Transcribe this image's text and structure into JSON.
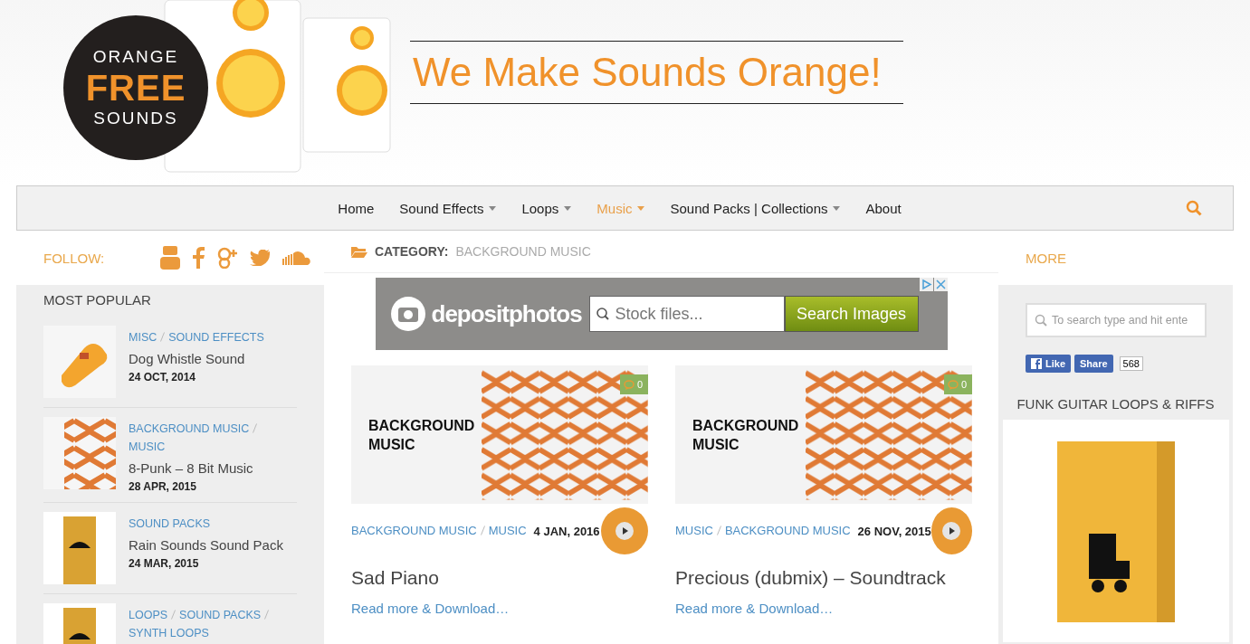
{
  "header": {
    "logo": {
      "lines": [
        "ORANGE",
        "FREE",
        "SOUNDS"
      ]
    },
    "tagline": "We Make Sounds Orange!"
  },
  "nav": {
    "items": [
      {
        "label": "Home",
        "has_menu": false,
        "selected": false
      },
      {
        "label": "Sound Effects",
        "has_menu": true,
        "selected": false
      },
      {
        "label": "Loops",
        "has_menu": true,
        "selected": false
      },
      {
        "label": "Music",
        "has_menu": true,
        "selected": true
      },
      {
        "label": "Sound Packs | Collections",
        "has_menu": true,
        "selected": false
      },
      {
        "label": "About",
        "has_menu": false,
        "selected": false
      }
    ]
  },
  "follow": {
    "label": "FOLLOW:"
  },
  "most_popular": {
    "title": "MOST POPULAR",
    "items": [
      {
        "kind": "whistle",
        "categories": [
          "MISC",
          "SOUND EFFECTS"
        ],
        "title": "Dog Whistle Sound",
        "date": "24 OCT, 2014"
      },
      {
        "kind": "pattern",
        "categories": [
          "BACKGROUND MUSIC",
          "MUSIC"
        ],
        "title": "8-Punk – 8 Bit Music",
        "date": "28 APR, 2015"
      },
      {
        "kind": "box",
        "categories": [
          "SOUND PACKS"
        ],
        "title": "Rain Sounds Sound Pack",
        "date": "24 MAR, 2015"
      },
      {
        "kind": "box",
        "categories": [
          "LOOPS",
          "SOUND PACKS",
          "SYNTH LOOPS"
        ]
      }
    ]
  },
  "category": {
    "label": "CATEGORY:",
    "name": "BACKGROUND MUSIC"
  },
  "ad": {
    "brand": "depositphotos",
    "placeholder": "Stock files...",
    "button": "Search Images"
  },
  "posts": [
    {
      "image_lines": [
        "BACKGROUND",
        "MUSIC"
      ],
      "comments": "0",
      "categories": [
        "BACKGROUND MUSIC",
        "MUSIC"
      ],
      "date": "4 JAN, 2016",
      "title": "Sad Piano",
      "link": "Read more & Download…"
    },
    {
      "image_lines": [
        "BACKGROUND",
        "MUSIC"
      ],
      "comments": "0",
      "categories": [
        "MUSIC",
        "BACKGROUND MUSIC"
      ],
      "date": "26 NOV, 2015",
      "title": "Precious (dubmix) – Soundtrack",
      "link": "Read more & Download…"
    }
  ],
  "more": {
    "title": "MORE",
    "search": {
      "placeholder": "To search type and hit ente"
    },
    "facebook": {
      "like": "Like",
      "share": "Share",
      "count": "568"
    },
    "widget_title": "FUNK GUITAR LOOPS & RIFFS"
  }
}
